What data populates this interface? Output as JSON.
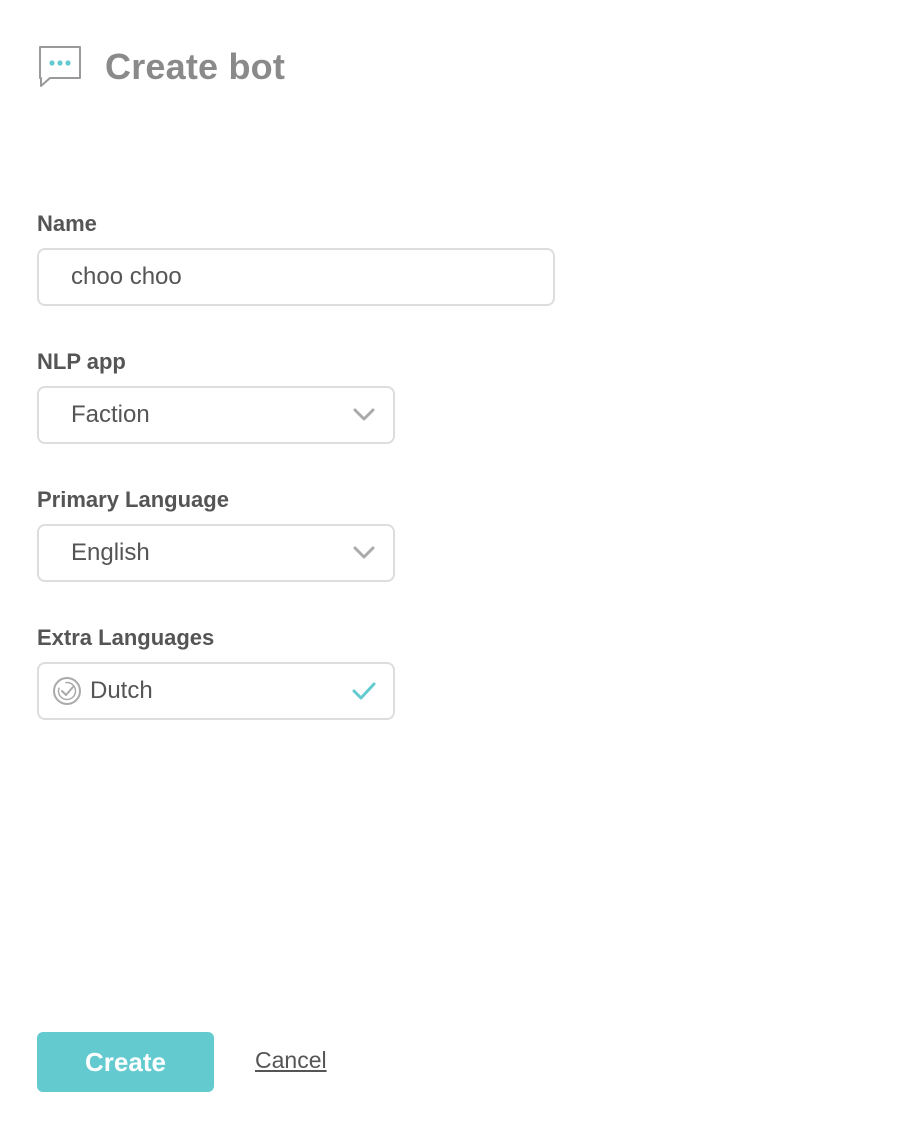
{
  "header": {
    "title": "Create bot",
    "icon": "chat-bubble-icon",
    "accent_color": "#63cad0"
  },
  "form": {
    "name": {
      "label": "Name",
      "value": "choo choo"
    },
    "nlp_app": {
      "label": "NLP app",
      "selected": "Faction"
    },
    "primary_language": {
      "label": "Primary Language",
      "selected": "English"
    },
    "extra_languages": {
      "label": "Extra Languages",
      "items": [
        {
          "label": "Dutch",
          "checked": true
        }
      ]
    }
  },
  "actions": {
    "create_label": "Create",
    "cancel_label": "Cancel"
  }
}
